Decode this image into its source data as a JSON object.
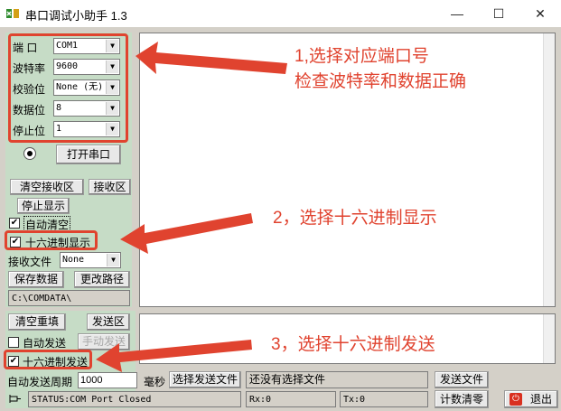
{
  "window": {
    "title": "串口调试小助手 1.3",
    "minimize": "—",
    "maximize": "☐",
    "close": "✕"
  },
  "settings": {
    "port": {
      "label": "端  口",
      "value": "COM1"
    },
    "baud": {
      "label": "波特率",
      "value": "9600"
    },
    "parity": {
      "label": "校验位",
      "value": "None (无)"
    },
    "databits": {
      "label": "数据位",
      "value": "8"
    },
    "stopbits": {
      "label": "停止位",
      "value": "1"
    },
    "open_button": "打开串口"
  },
  "receive": {
    "clear_button": "清空接收区",
    "area_button": "接收区",
    "stop_display_button": "停止显示",
    "auto_clear": {
      "label": "自动清空",
      "checked": "✔"
    },
    "hex_display": {
      "label": "十六进制显示",
      "checked": "✔"
    },
    "file_label": "接收文件",
    "file_value": "None",
    "save_button": "保存数据",
    "change_path_button": "更改路径",
    "path": "C:\\COMDATA\\"
  },
  "send": {
    "clear_button": "清空重填",
    "area_button": "发送区",
    "auto_send": {
      "label": "自动发送",
      "checked": ""
    },
    "manual_send_button": "手动发送",
    "hex_send": {
      "label": "十六进制发送",
      "checked": "✔"
    },
    "period_label": "自动发送周期",
    "period_value": "1000",
    "ms_label": "毫秒",
    "select_file_button": "选择发送文件",
    "file_status": "还没有选择文件",
    "send_file_button": "发送文件"
  },
  "status": {
    "text": "STATUS:COM Port Closed",
    "rx": "Rx:0",
    "tx": "Tx:0",
    "count_clear_button": "计数清零",
    "exit_button": "退出"
  },
  "annotations": {
    "a1_line1": "1,选择对应端口号",
    "a1_line2": "检查波特率和数据正确",
    "a2": "2，选择十六进制显示",
    "a3": "3，选择十六进制发送"
  },
  "colors": {
    "accent_red": "#e0432f",
    "panel_green": "#c6dcc6"
  }
}
